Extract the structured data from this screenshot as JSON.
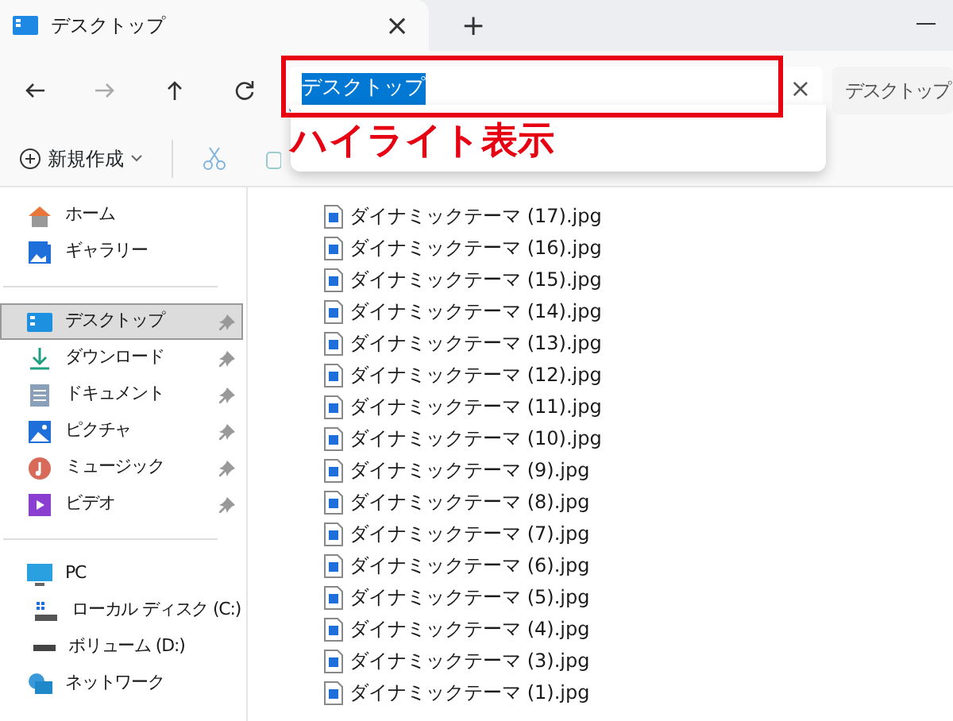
{
  "tab": {
    "title": "デスクトップ",
    "close": "×",
    "new": "+"
  },
  "address": {
    "value": "デスクトップ",
    "highlighted": true,
    "clear": "×"
  },
  "search": {
    "value": "デスクトップ"
  },
  "annotation": {
    "label": "ハイライト表示"
  },
  "toolbar": {
    "new_label": "新規作成"
  },
  "sidebar": [
    [
      {
        "label": "ホーム",
        "kind": "home",
        "selected": false
      },
      {
        "label": "ギャラリー",
        "kind": "gallery",
        "selected": false
      }
    ],
    [
      {
        "label": "デスクトップ",
        "kind": "desktop",
        "selected": true,
        "pinned": true
      },
      {
        "label": "ダウンロード",
        "kind": "download",
        "selected": false,
        "pinned": true
      },
      {
        "label": "ドキュメント",
        "kind": "document",
        "selected": false,
        "pinned": true
      },
      {
        "label": "ピクチャ",
        "kind": "pictures",
        "selected": false,
        "pinned": true
      },
      {
        "label": "ミュージック",
        "kind": "music",
        "selected": false,
        "pinned": true
      },
      {
        "label": "ビデオ",
        "kind": "video",
        "selected": false,
        "pinned": true
      }
    ],
    [
      {
        "label": "PC",
        "kind": "pc",
        "selected": false,
        "children": [
          {
            "label": "ローカル ディスク (C:)",
            "kind": "system-drive",
            "selected": false
          },
          {
            "label": "ボリューム (D:)",
            "kind": "drive",
            "selected": false
          }
        ]
      },
      {
        "label": "ネットワーク",
        "kind": "network",
        "selected": false
      }
    ]
  ],
  "files": [
    "ダイナミックテーマ (17).jpg",
    "ダイナミックテーマ (16).jpg",
    "ダイナミックテーマ (15).jpg",
    "ダイナミックテーマ (14).jpg",
    "ダイナミックテーマ (13).jpg",
    "ダイナミックテーマ (12).jpg",
    "ダイナミックテーマ (11).jpg",
    "ダイナミックテーマ (10).jpg",
    "ダイナミックテーマ (9).jpg",
    "ダイナミックテーマ (8).jpg",
    "ダイナミックテーマ (7).jpg",
    "ダイナミックテーマ (6).jpg",
    "ダイナミックテーマ (5).jpg",
    "ダイナミックテーマ (4).jpg",
    "ダイナミックテーマ (3).jpg",
    "ダイナミックテーマ (1).jpg"
  ]
}
